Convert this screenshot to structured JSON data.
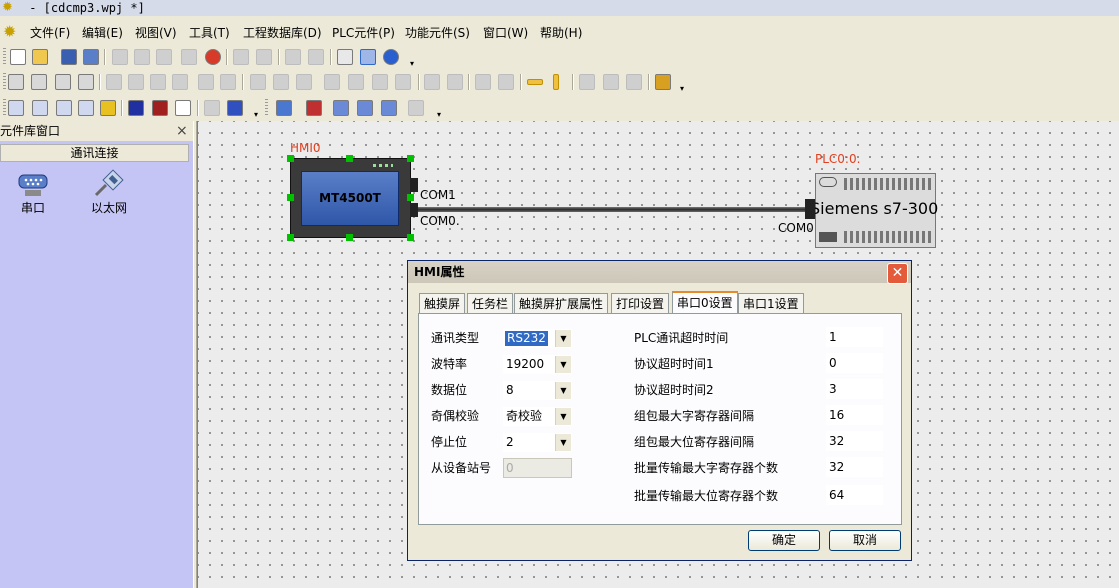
{
  "window": {
    "title": " - [cdcmp3.wpj *]"
  },
  "menu": [
    "文件(F)",
    "编辑(E)",
    "视图(V)",
    "工具(T)",
    "工程数据库(D)",
    "PLC元件(P)",
    "功能元件(S)",
    "窗口(W)",
    "帮助(H)"
  ],
  "left_panel": {
    "title": "元件库窗口",
    "close": "×",
    "category": "通讯连接",
    "items": [
      {
        "label": "串口",
        "icon": "serial-port-icon"
      },
      {
        "label": "以太网",
        "icon": "ethernet-icon"
      }
    ]
  },
  "canvas": {
    "hmi": {
      "name": "HMI0",
      "model": "MT4500T",
      "port1": "COM1",
      "port0": "COM0."
    },
    "plc": {
      "name": "PLC0:0.",
      "model": "Siemens s7-300",
      "port": "COM0"
    }
  },
  "dialog": {
    "title": "HMI属性",
    "close": "✕",
    "tabs": [
      "触摸屏",
      "任务栏",
      "触摸屏扩展属性",
      "打印设置",
      "串口0设置",
      "串口1设置"
    ],
    "active_tab": "串口0设置",
    "left_fields": [
      {
        "label": "通讯类型",
        "value": "RS232",
        "kind": "combo"
      },
      {
        "label": "波特率",
        "value": "19200",
        "kind": "combo"
      },
      {
        "label": "数据位",
        "value": "8",
        "kind": "combo"
      },
      {
        "label": "奇偶校验",
        "value": "奇校验",
        "kind": "combo"
      },
      {
        "label": "停止位",
        "value": "2",
        "kind": "combo"
      },
      {
        "label": "从设备站号",
        "value": "0",
        "kind": "disabled-input"
      }
    ],
    "right_fields": [
      {
        "label": "PLC通讯超时时间",
        "value": "1"
      },
      {
        "label": "协议超时时间1",
        "value": "0"
      },
      {
        "label": "协议超时时间2",
        "value": "3"
      },
      {
        "label": "组包最大字寄存器间隔",
        "value": "16"
      },
      {
        "label": "组包最大位寄存器间隔",
        "value": "32"
      },
      {
        "label": "批量传输最大字寄存器个数",
        "value": "32"
      },
      {
        "label": "批量传输最大位寄存器个数",
        "value": "64"
      }
    ],
    "ok_label": "确定",
    "cancel_label": "取消"
  }
}
